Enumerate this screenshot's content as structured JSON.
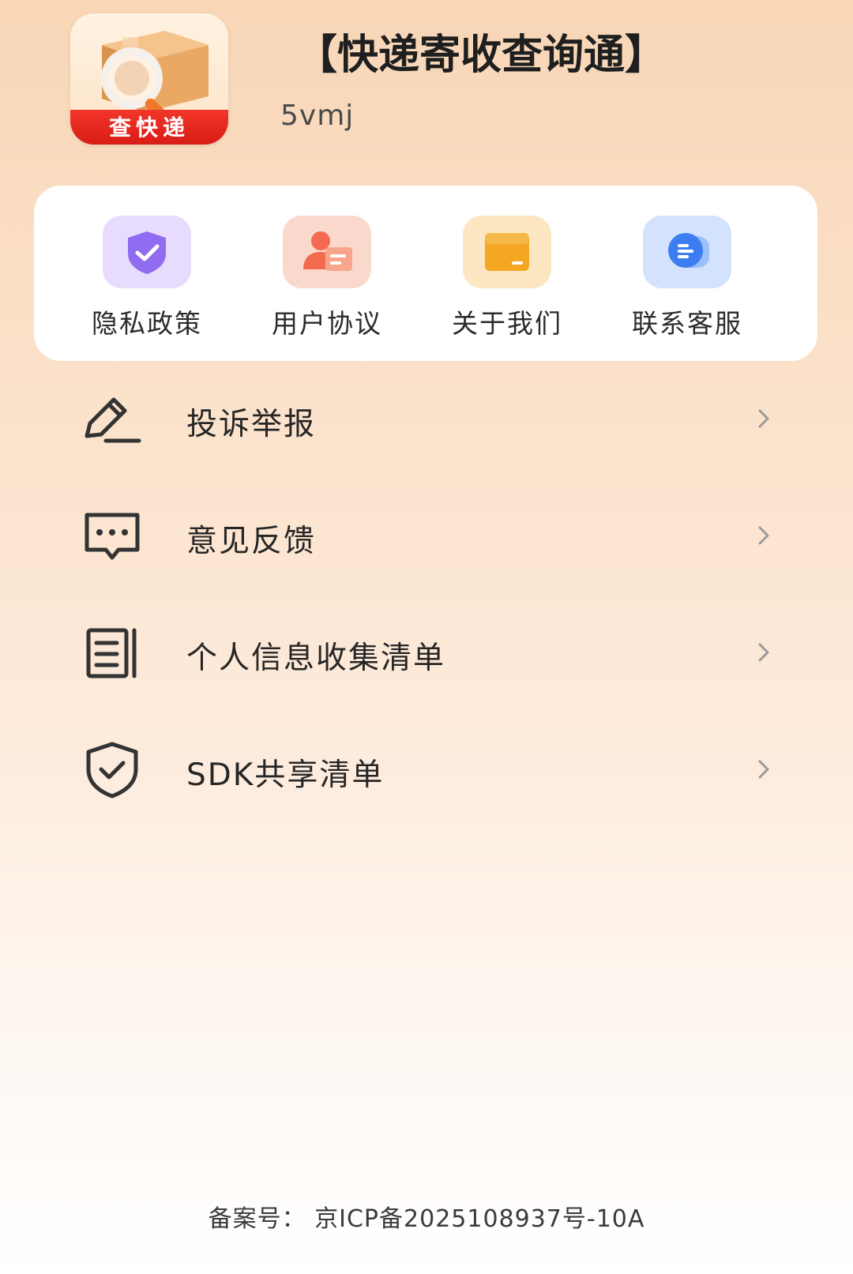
{
  "header": {
    "logo_label": "查快递",
    "title": "【快递寄收查询通】",
    "subtitle": "5vmj"
  },
  "quick_links": [
    {
      "label": "隐私政策",
      "icon": "shield-check-icon",
      "color": "#8f6cf0"
    },
    {
      "label": "用户协议",
      "icon": "user-card-icon",
      "color": "#f26a4f"
    },
    {
      "label": "关于我们",
      "icon": "folder-icon",
      "color": "#f5a623"
    },
    {
      "label": "联系客服",
      "icon": "chat-bubble-icon",
      "color": "#3d7df2"
    }
  ],
  "menu": [
    {
      "label": "投诉举报",
      "icon": "pencil-icon"
    },
    {
      "label": "意见反馈",
      "icon": "message-dots-icon"
    },
    {
      "label": "个人信息收集清单",
      "icon": "document-list-icon"
    },
    {
      "label": "SDK共享清单",
      "icon": "shield-check-outline-icon"
    }
  ],
  "footer": {
    "icp": "备案号： 京ICP备2025108937号-10A"
  }
}
